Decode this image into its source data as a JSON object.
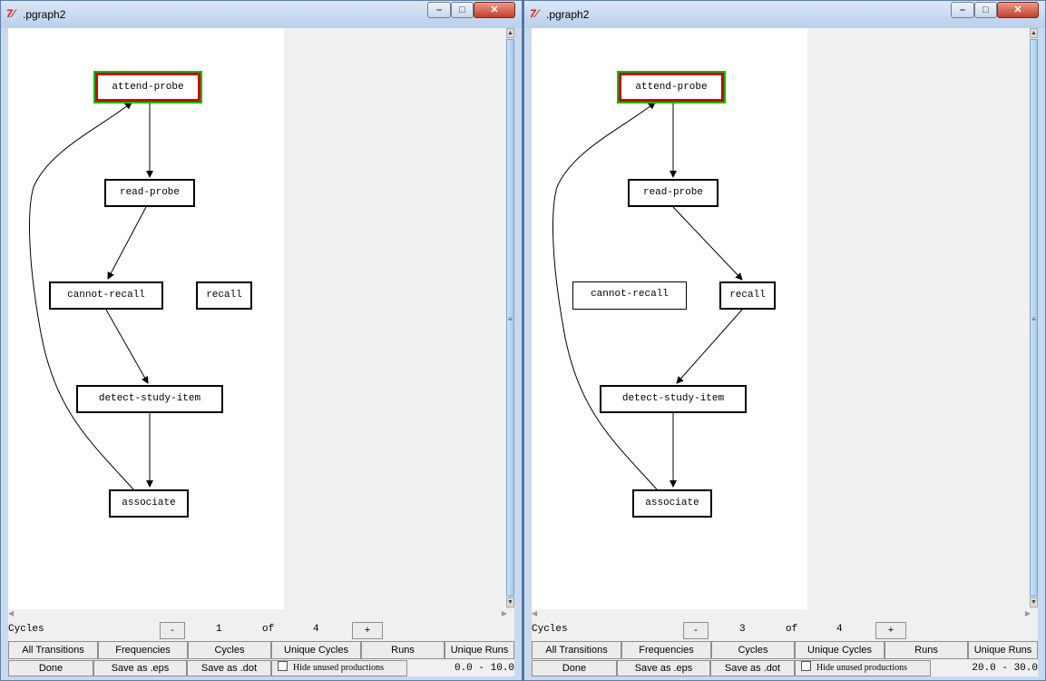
{
  "windows": [
    {
      "title": ".pgraph2",
      "controls": {
        "minimize": "–",
        "maximize": "□",
        "close": "✕"
      },
      "nodes": {
        "attend_probe": "attend-probe",
        "read_probe": "read-probe",
        "cannot_recall": "cannot-recall",
        "recall": "recall",
        "detect_study_item": "detect-study-item",
        "associate": "associate"
      },
      "active_node": "attend-probe",
      "edges": [
        [
          "attend-probe",
          "read-probe"
        ],
        [
          "read-probe",
          "cannot-recall"
        ],
        [
          "cannot-recall",
          "detect-study-item"
        ],
        [
          "detect-study-item",
          "associate"
        ],
        [
          "associate",
          "attend-probe"
        ]
      ],
      "nav": {
        "label": "Cycles",
        "minus": "-",
        "current": "1",
        "of": "of",
        "total": "4",
        "plus": "+"
      },
      "tabs": [
        "All Transitions",
        "Frequencies",
        "Cycles",
        "Unique Cycles",
        "Runs",
        "Unique Runs"
      ],
      "actions": {
        "done": "Done",
        "save_eps": "Save as .eps",
        "save_dot": "Save as .dot",
        "hide_unused": "Hide unused productions"
      },
      "range": "0.0 - 10.0"
    },
    {
      "title": ".pgraph2",
      "controls": {
        "minimize": "–",
        "maximize": "□",
        "close": "✕"
      },
      "nodes": {
        "attend_probe": "attend-probe",
        "read_probe": "read-probe",
        "cannot_recall": "cannot-recall",
        "recall": "recall",
        "detect_study_item": "detect-study-item",
        "associate": "associate"
      },
      "active_node": "attend-probe",
      "edges": [
        [
          "attend-probe",
          "read-probe"
        ],
        [
          "read-probe",
          "recall"
        ],
        [
          "recall",
          "detect-study-item"
        ],
        [
          "detect-study-item",
          "associate"
        ],
        [
          "associate",
          "attend-probe"
        ]
      ],
      "nav": {
        "label": "Cycles",
        "minus": "-",
        "current": "3",
        "of": "of",
        "total": "4",
        "plus": "+"
      },
      "tabs": [
        "All Transitions",
        "Frequencies",
        "Cycles",
        "Unique Cycles",
        "Runs",
        "Unique Runs"
      ],
      "actions": {
        "done": "Done",
        "save_eps": "Save as .eps",
        "save_dot": "Save as .dot",
        "hide_unused": "Hide unused productions"
      },
      "range": "20.0 - 30.0"
    }
  ]
}
